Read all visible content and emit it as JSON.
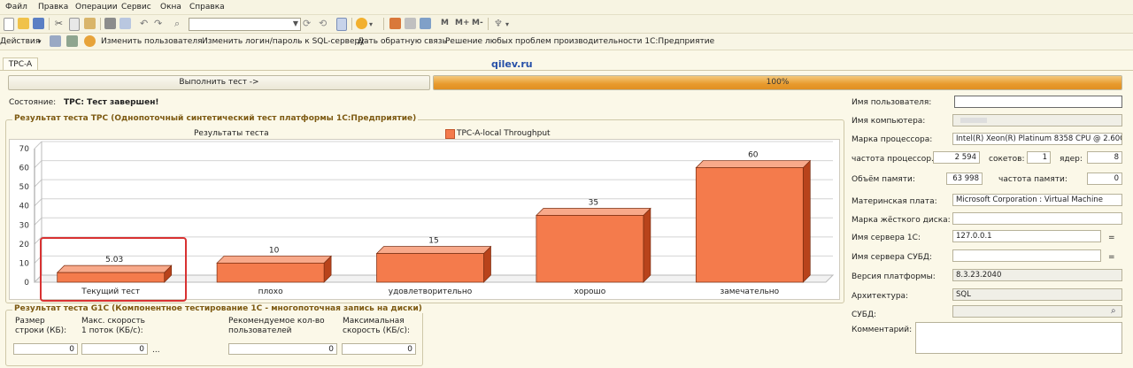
{
  "menu": [
    "Файл",
    "Правка",
    "Операции",
    "Сервис",
    "Окна",
    "Справка"
  ],
  "actions_bar": {
    "actions_label": "Действия",
    "items": [
      "Изменить пользователя",
      "Изменить логин/пароль к SQL-серверу",
      "Дать обратную связь",
      "Решение любых проблем производительности 1С:Предприятие"
    ]
  },
  "tab": "TPC-A",
  "site": "qilev.ru",
  "run_button": "Выполнить тест ->",
  "progress": {
    "value": 100,
    "label": "100%"
  },
  "state": {
    "label": "Состояние:",
    "value": "TPC: Тест завершен!"
  },
  "tpc_group_title": "Результат теста TPC (Однопоточный синтетический тест платформы 1С:Предприятие)",
  "chart_data": {
    "type": "bar",
    "title": "Результаты теста",
    "categories": [
      "Текущий тест",
      "плохо",
      "удовлетворительно",
      "хорошо",
      "замечательно"
    ],
    "series": [
      {
        "name": "TPC-A-local Throughput",
        "values": [
          5.03,
          10,
          15,
          35,
          60
        ]
      }
    ],
    "value_labels": [
      "5.03",
      "10",
      "15",
      "35",
      "60"
    ],
    "yticks": [
      "0",
      "10",
      "20",
      "30",
      "40",
      "50",
      "60",
      "70"
    ],
    "ylim": [
      0,
      70
    ],
    "grid": true,
    "legend": "top",
    "bar_color": "#f47b4c"
  },
  "g1c": {
    "title": "Результат теста G1C (Компонентное тестирование 1С - многопоточная запись на диски)",
    "labels": [
      "Размер строки (КБ):",
      "Макс. скорость 1 поток (КБ/с):",
      "Рекомендуемое кол-во пользователей",
      "Максимальная скорость (КБ/с):"
    ],
    "values": [
      "0",
      "0",
      "0",
      "0"
    ],
    "ellipsis": "..."
  },
  "info": {
    "user_label": "Имя пользователя:",
    "user_value": "",
    "computer_label": "Имя компьютера:",
    "cpu_label": "Марка процессора:",
    "cpu_value": "Intel(R) Xeon(R) Platinum 8358 CPU @ 2.60GHz",
    "freq_label": "частота процессор...",
    "freq_value": "2 594",
    "sockets_label": "сокетов:",
    "sockets_value": "1",
    "cores_label": "ядер:",
    "cores_value": "8",
    "mem_label": "Объём памяти:",
    "mem_value": "63 998",
    "memfreq_label": "частота памяти:",
    "memfreq_value": "0",
    "board_label": "Материнская плата:",
    "board_value": "Microsoft Corporation : Virtual Machine",
    "disk_label": "Марка жёсткого диска:",
    "disk_value": "",
    "server1c_label": "Имя сервера 1С:",
    "server1c_value": "127.0.0.1",
    "dbms_server_label": "Имя сервера СУБД:",
    "dbms_server_value": "",
    "platform_label": "Версия платформы:",
    "platform_value": "8.3.23.2040",
    "arch_label": "Архитектура:",
    "arch_value": "SQL",
    "dbms_label": "СУБД:",
    "dbms_value": "",
    "comment_label": "Комментарий:",
    "comment_value": "",
    "eq_sign": "="
  }
}
